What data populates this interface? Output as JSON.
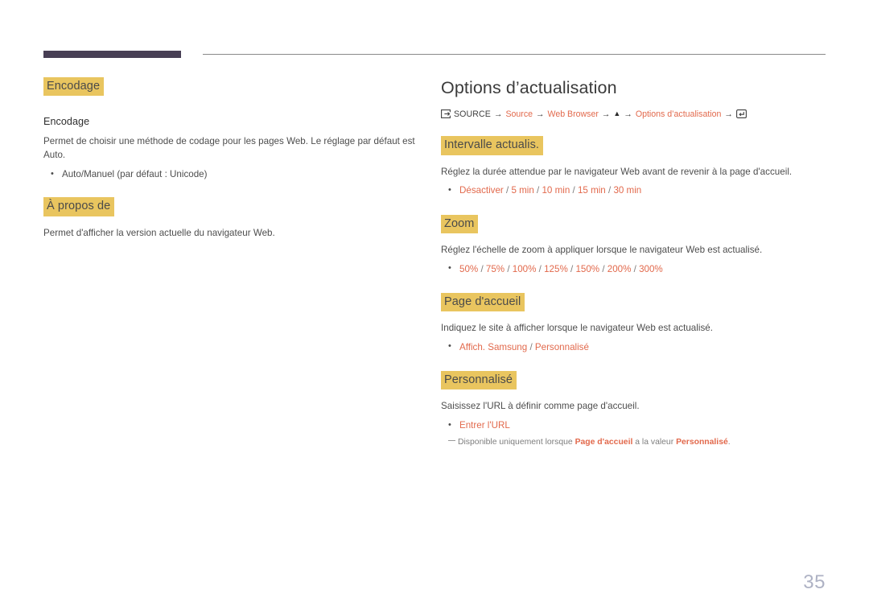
{
  "document": {
    "page_number": "35",
    "colors": {
      "highlight": "#e9c55f",
      "accent_red": "#e2694c",
      "rule_dark": "#483f55",
      "rule_light": "#8a8a8a",
      "page_number": "#aeb2c4",
      "body_text": "#4d4d4d"
    }
  },
  "left_column": {
    "sections": [
      {
        "heading": "Encodage",
        "subheading": "Encodage",
        "body": "Permet de choisir une méthode de codage pour les pages Web. Le réglage par défaut est Auto.",
        "bullets": [
          {
            "text": "Auto/Manuel (par défaut : Unicode)"
          }
        ]
      },
      {
        "heading": "À propos de",
        "body": "Permet d'afficher la version actuelle du navigateur Web."
      }
    ]
  },
  "right_column": {
    "title": "Options d’actualisation",
    "breadcrumb": {
      "source_icon": "source-input-icon",
      "enter_icon": "enter-key-icon",
      "up_icon": "up-triangle-icon",
      "arrow": "→",
      "items": [
        {
          "label": "SOURCE",
          "style": "plain"
        },
        {
          "label": "Source",
          "style": "red"
        },
        {
          "label": "Web Browser",
          "style": "red"
        },
        {
          "label": "▲",
          "style": "triangle"
        },
        {
          "label": "Options d’actualisation",
          "style": "red"
        }
      ]
    },
    "sections": [
      {
        "heading": "Intervalle actualis.",
        "body": "Réglez la durée attendue par le navigateur Web avant de revenir à la page d'accueil.",
        "options": [
          "Désactiver",
          "5 min",
          "10 min",
          "15 min",
          "30 min"
        ]
      },
      {
        "heading": "Zoom",
        "body": "Réglez l'échelle de zoom à appliquer lorsque le navigateur Web est actualisé.",
        "options": [
          "50%",
          "75%",
          "100%",
          "125%",
          "150%",
          "200%",
          "300%"
        ]
      },
      {
        "heading": "Page d'accueil",
        "body": "Indiquez le site à afficher lorsque le navigateur Web est actualisé.",
        "options": [
          "Affich. Samsung",
          "Personnalisé"
        ]
      },
      {
        "heading": "Personnalisé",
        "body": "Saisissez l'URL à définir comme page d'accueil.",
        "options": [
          "Entrer l'URL"
        ],
        "note": {
          "prefix": "Disponible uniquement lorsque ",
          "term1": "Page d'accueil",
          "middle": " a la valeur ",
          "term2": "Personnalisé",
          "suffix": "."
        }
      }
    ]
  }
}
